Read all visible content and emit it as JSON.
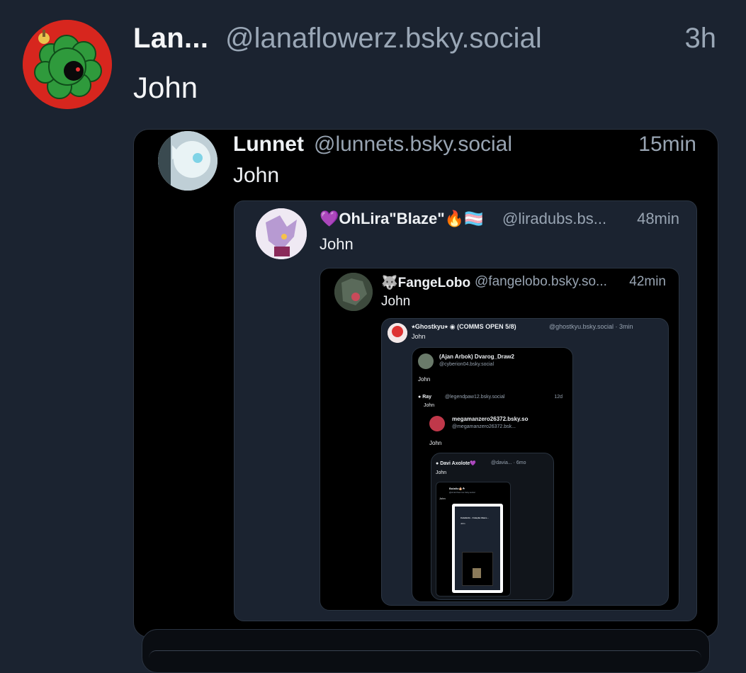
{
  "post": {
    "author_name": "Lan...",
    "handle": "@lanaflowerz.bsky.social",
    "time": "3h",
    "text": "John",
    "avatar_icon": "green-cloud-creature-avatar-icon"
  },
  "quote1": {
    "author_name": "Lunnet",
    "handle": "@lunnets.bsky.social",
    "time": "15min",
    "text": "John"
  },
  "quote2": {
    "author_prefix": "💜",
    "author_name": "OhLira\"Blaze\"",
    "author_suffix": "🔥🏳️‍⚧️",
    "handle": "@liradubs.bs...",
    "time": "48min",
    "text": "John"
  },
  "quote3": {
    "author_prefix": "🐺",
    "author_name": "FangeLobo",
    "handle": "@fangelobo.bsky.so...",
    "time": "42min",
    "text": "John"
  },
  "quote4": {
    "author_name": "⭑Ghostkyu⭑ ◉ (COMMS OPEN 5/8)",
    "handle": "@ghostkyu.bsky.social · 3min",
    "text": "John"
  },
  "quote5": {
    "author_name": "(Ajan Arbok) Dvarog_Draw2",
    "handle": "@cyberion04.bsky.social",
    "text": "John"
  },
  "quote6": {
    "author_name": "Ray",
    "handle": "@legendpaw12.bsky.social",
    "time": "12d",
    "text": "John"
  },
  "quote7": {
    "author_name": "megamanzero26372.bsky.so",
    "handle": "@megamanzero26372.bsk...",
    "text": "John"
  },
  "quote8": {
    "author_name": "Davi Axolote💜",
    "handle": "@davia... · 6mo",
    "text": "John"
  },
  "quote9": {
    "author_name": "Bolaño🎂☘",
    "handle": "@victorrbemmo.bsky.social",
    "text": "John"
  },
  "quote10": {
    "author_name": "Cutebirds · Coleção libere...",
    "text": "John"
  }
}
